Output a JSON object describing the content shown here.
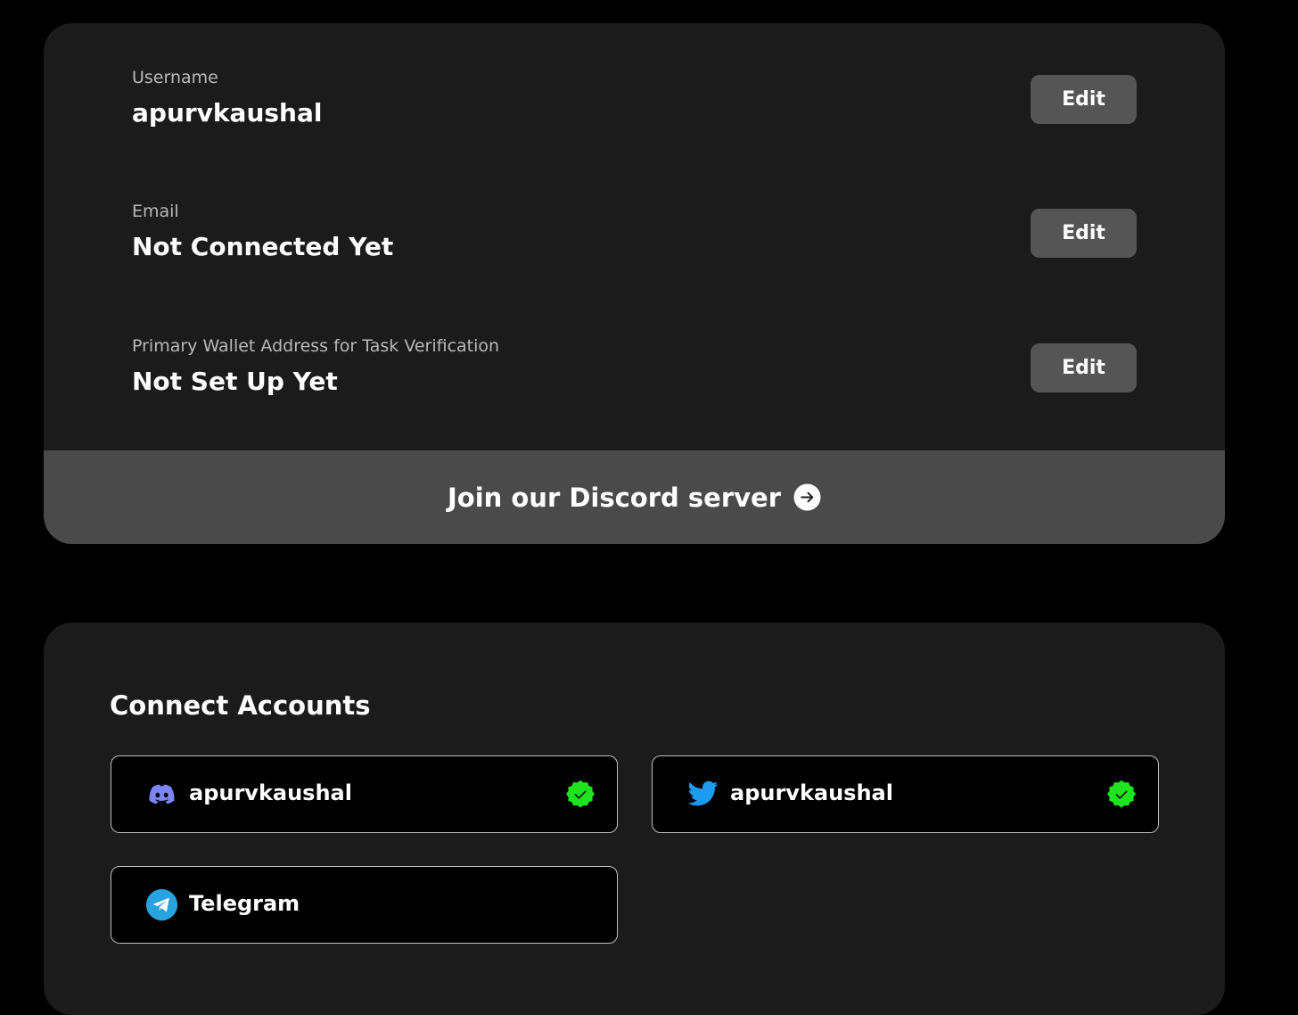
{
  "profile": {
    "fields": [
      {
        "label": "Username",
        "value": "apurvkaushal",
        "edit_label": "Edit"
      },
      {
        "label": "Email",
        "value": "Not Connected Yet",
        "edit_label": "Edit"
      },
      {
        "label": "Primary Wallet Address for Task Verification",
        "value": "Not Set Up Yet",
        "edit_label": "Edit"
      }
    ],
    "discord_cta": {
      "label": "Join our Discord server",
      "icon": "arrow-right-circle-icon"
    }
  },
  "connect": {
    "title": "Connect Accounts",
    "accounts": [
      {
        "platform": "discord",
        "icon": "discord-icon",
        "name": "apurvkaushal",
        "verified": true
      },
      {
        "platform": "twitter",
        "icon": "twitter-icon",
        "name": "apurvkaushal",
        "verified": true
      },
      {
        "platform": "telegram",
        "icon": "telegram-icon",
        "name": "Telegram",
        "verified": false
      }
    ]
  },
  "colors": {
    "page_bg": "#000000",
    "card_bg": "#1b1b1b",
    "button_bg": "#555555",
    "cta_bar_bg": "#4a4a4a",
    "verified_green": "#1ee31e",
    "discord_blurple": "#7c85f5",
    "twitter_blue": "#1d9bf0",
    "telegram_blue": "#29a3e0"
  }
}
